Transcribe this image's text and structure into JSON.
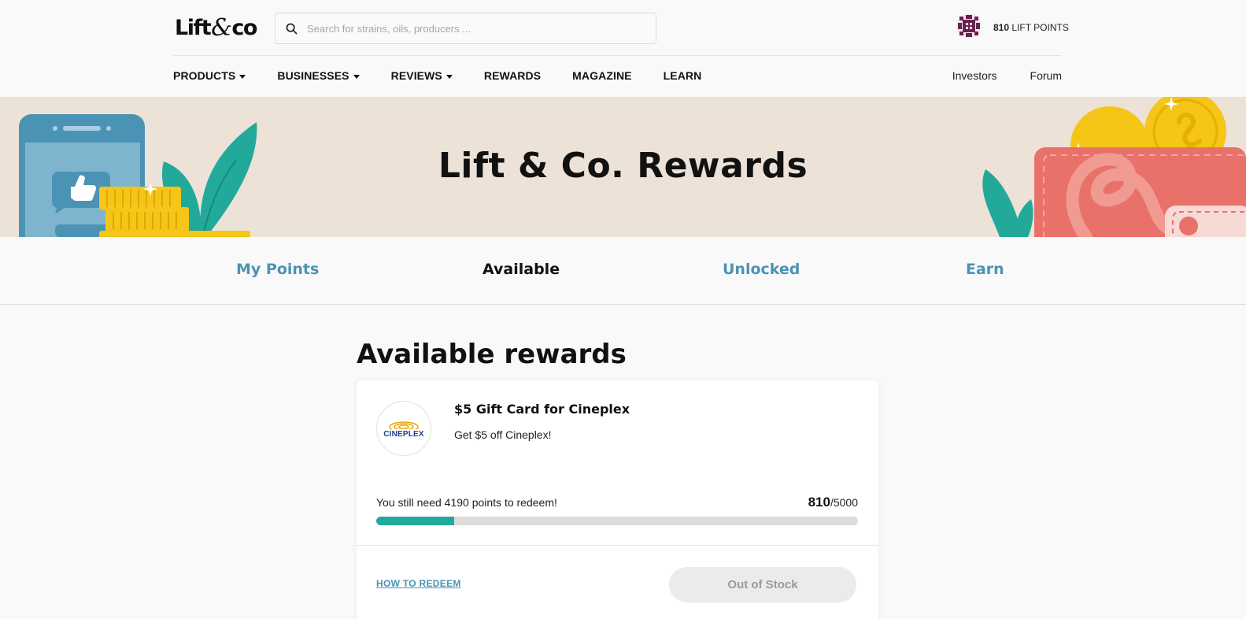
{
  "brand": {
    "logo_left": "Lift",
    "logo_amp": "&",
    "logo_right": "co"
  },
  "search": {
    "placeholder": "Search for strains, oils, producers ..."
  },
  "user": {
    "points_value": "810",
    "points_label": "LIFT POINTS"
  },
  "nav": {
    "items": [
      {
        "label": "PRODUCTS",
        "dropdown": true
      },
      {
        "label": "BUSINESSES",
        "dropdown": true
      },
      {
        "label": "REVIEWS",
        "dropdown": true
      },
      {
        "label": "REWARDS",
        "dropdown": false
      },
      {
        "label": "MAGAZINE",
        "dropdown": false
      },
      {
        "label": "LEARN",
        "dropdown": false
      }
    ],
    "right": [
      "Investors",
      "Forum"
    ]
  },
  "hero": {
    "title": "Lift & Co. Rewards"
  },
  "tabs": [
    {
      "label": "My Points",
      "active": false
    },
    {
      "label": "Available",
      "active": true
    },
    {
      "label": "Unlocked",
      "active": false
    },
    {
      "label": "Earn",
      "active": false
    }
  ],
  "main": {
    "title": "Available rewards",
    "reward": {
      "brand_logo_text": "CINEPLEX",
      "title": "$5 Gift Card for Cineplex",
      "description": "Get $5 off Cineplex!",
      "progress_message": "You still need 4190 points to redeem!",
      "current_points": "810",
      "required_points": "/5000",
      "progress_fraction": 0.162,
      "how_to_label": "HOW TO REDEEM",
      "button_label": "Out of Stock"
    }
  },
  "colors": {
    "accent_blue": "#4b93b4",
    "progress_teal": "#22a99a",
    "hero_bg": "#ece2d7"
  }
}
